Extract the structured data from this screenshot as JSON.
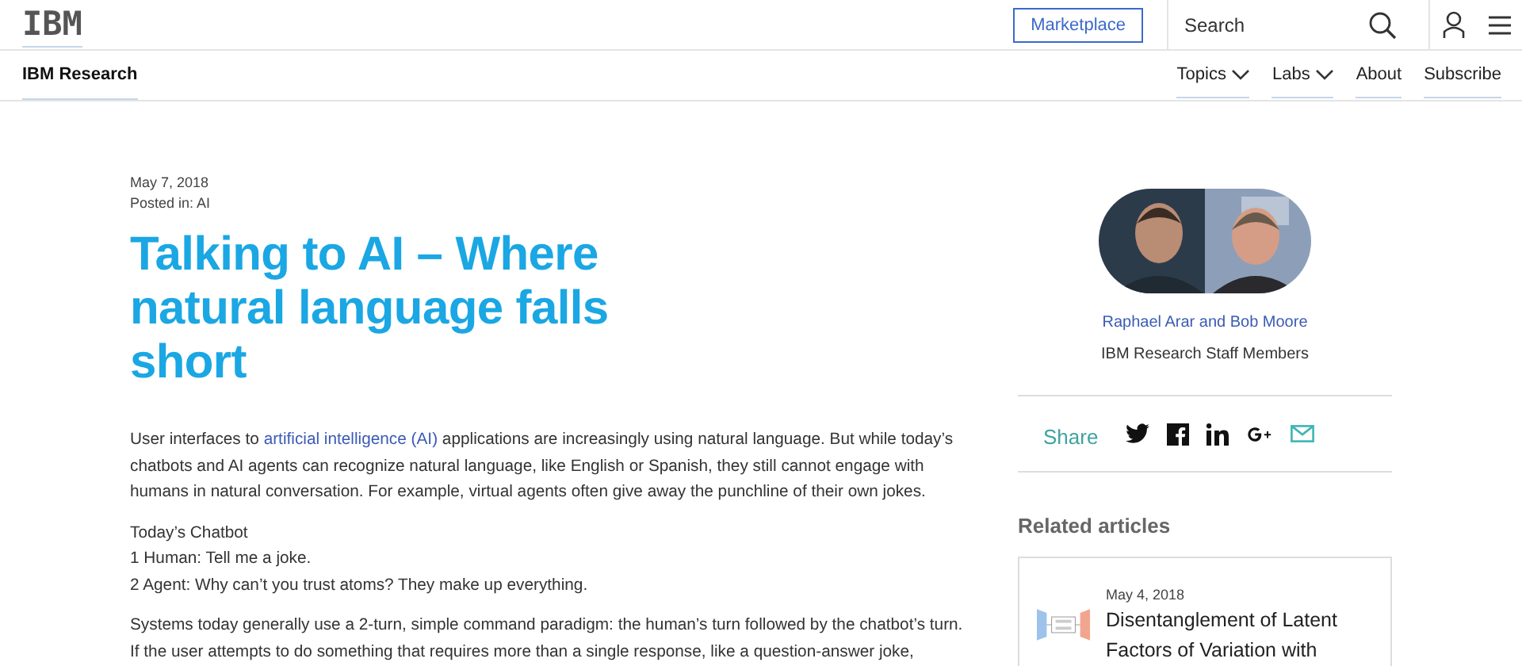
{
  "header": {
    "logo": "IBM",
    "marketplace": "Marketplace",
    "search": {
      "placeholder": "Search"
    }
  },
  "subnav": {
    "title": "IBM Research",
    "items": [
      {
        "label": "Topics",
        "kind": "dropdown"
      },
      {
        "label": "Labs",
        "kind": "dropdown"
      },
      {
        "label": "About",
        "kind": "link"
      },
      {
        "label": "Subscribe",
        "kind": "link"
      }
    ]
  },
  "article": {
    "date": "May 7, 2018",
    "posted_in": "Posted in: AI",
    "title": "Talking to AI – Where natural language falls short",
    "intro": {
      "before": "User interfaces to ",
      "link": "artificial intelligence (AI)",
      "after": " applications are increasingly using natural language. But while today’s chatbots and AI agents can recognize natural language, like English or Spanish, they still cannot engage with humans in natural conversation. For example, virtual agents often give away the punchline of their own jokes."
    },
    "example_lines": [
      "Today’s Chatbot",
      "1 Human: Tell me a joke.",
      "2 Agent: Why can’t you trust atoms? They make up everything."
    ],
    "paragraph": "Systems today generally use a 2-turn, simple command paradigm: the human’s turn followed by the chatbot’s turn. If the user attempts to do something that requires more than a single response, like a question-answer joke,"
  },
  "sidebar": {
    "authors": "Raphael Arar and Bob Moore",
    "role": "IBM Research Staff Members",
    "share_label": "Share",
    "share_icons": [
      {
        "kind": "twitter"
      },
      {
        "kind": "facebook"
      },
      {
        "kind": "linkedin"
      },
      {
        "kind": "googleplus"
      },
      {
        "kind": "email"
      }
    ],
    "related_title": "Related articles",
    "related": [
      {
        "date": "May 4, 2018",
        "title": "Disentanglement of Latent Factors of Variation with"
      }
    ]
  }
}
